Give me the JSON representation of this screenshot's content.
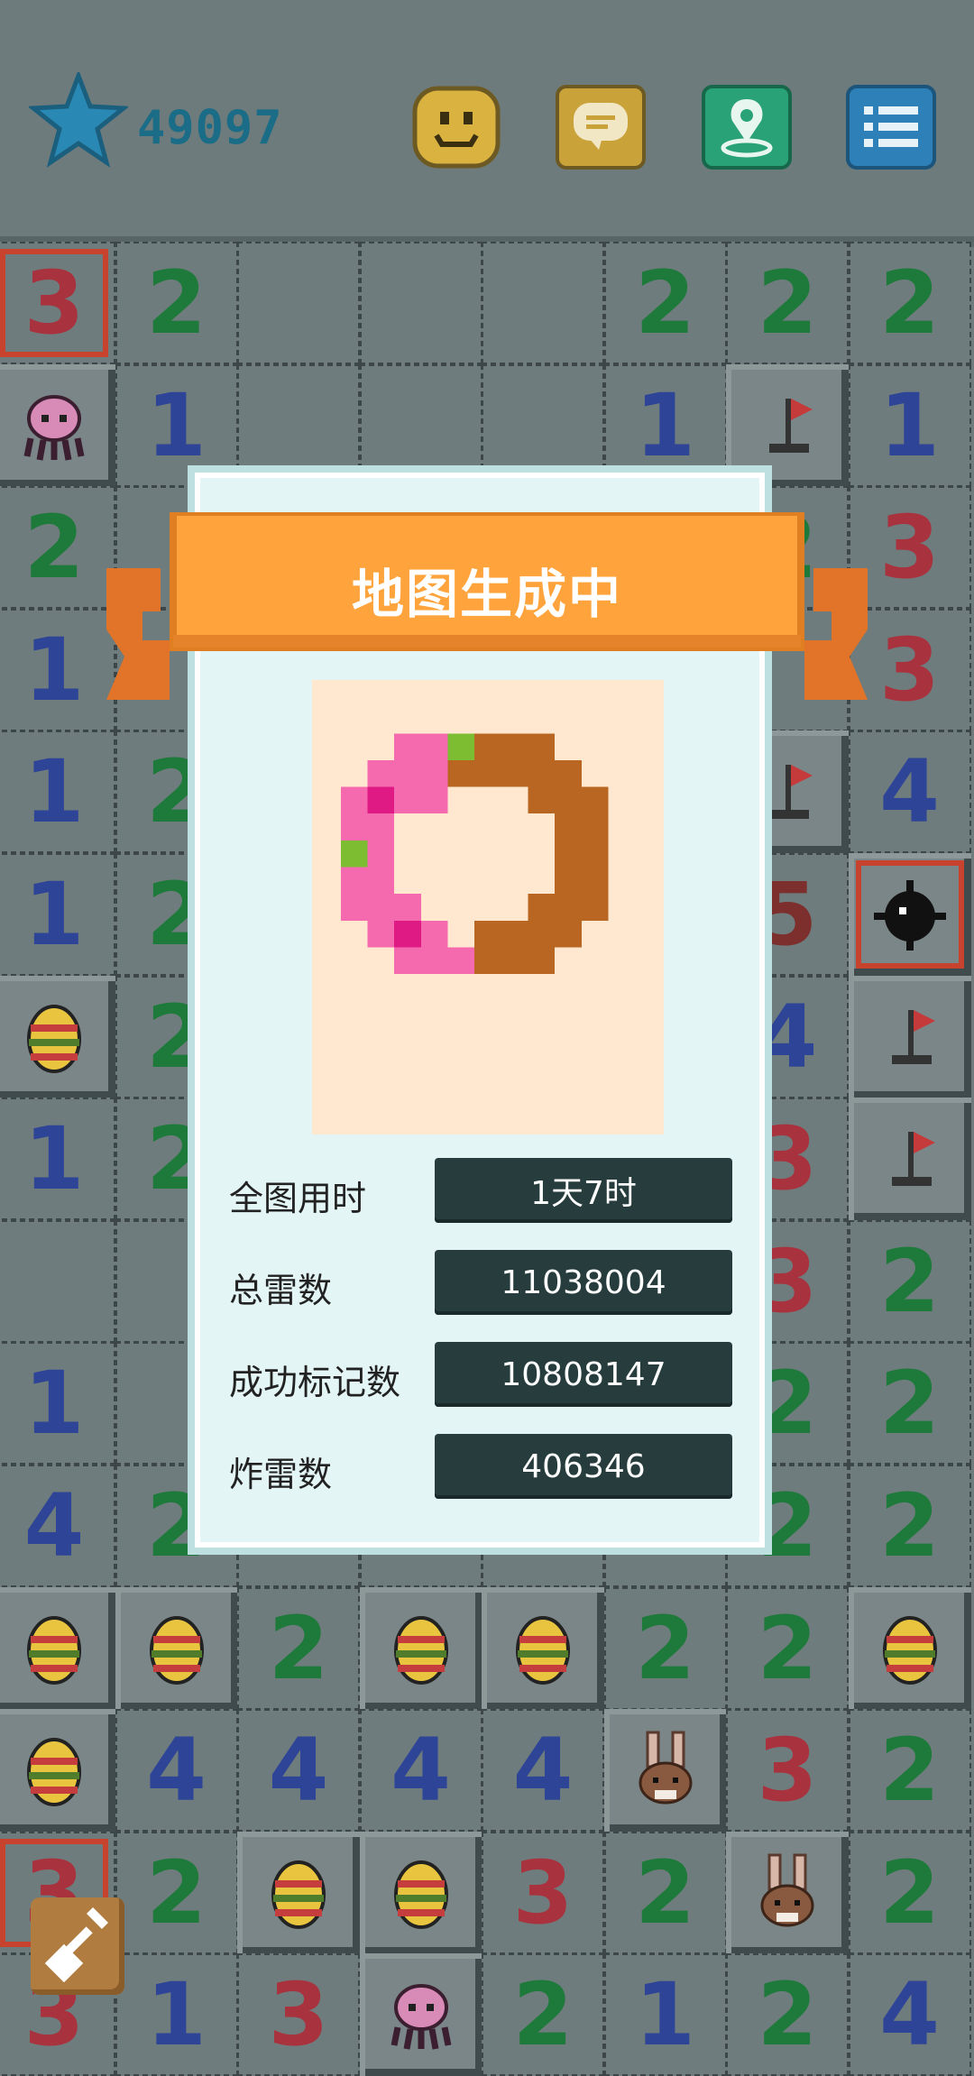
{
  "hud": {
    "star_icon": "star-icon",
    "score": "49097",
    "buttons": [
      "smiley-icon",
      "chat-icon",
      "map-pin-icon",
      "menu-list-icon"
    ]
  },
  "board": {
    "colors": {
      "n1": "#2e4496",
      "n2": "#1e7a3a",
      "n3": "#a8333e",
      "n4": "#2e4496",
      "n5": "#7c2f2c"
    },
    "rows": [
      [
        "3",
        "2",
        "",
        "",
        "",
        "2",
        "2",
        "2"
      ],
      [
        "octopus",
        "1",
        "",
        "",
        "",
        "1",
        "flag",
        "1"
      ],
      [
        "2",
        "",
        "",
        "",
        "",
        "",
        "2",
        "3"
      ],
      [
        "1",
        "",
        "",
        "",
        "",
        "",
        "",
        "3"
      ],
      [
        "1",
        "2",
        "",
        "",
        "",
        "",
        "flag",
        "4"
      ],
      [
        "1",
        "2",
        "",
        "",
        "",
        "",
        "5",
        "mine"
      ],
      [
        "egg",
        "2",
        "",
        "",
        "",
        "",
        "4",
        "flag"
      ],
      [
        "1",
        "2",
        "",
        "",
        "",
        "",
        "3",
        "flag"
      ],
      [
        "",
        "",
        "",
        "",
        "",
        "",
        "3",
        "2"
      ],
      [
        "1",
        "",
        "",
        "",
        "",
        "",
        "2",
        "2"
      ],
      [
        "4",
        "2",
        "",
        "",
        "",
        "",
        "2",
        "2"
      ],
      [
        "egg",
        "egg",
        "2",
        "egg",
        "egg",
        "2",
        "2",
        "egg"
      ],
      [
        "egg",
        "4",
        "4",
        "4",
        "4",
        "bunny",
        "3",
        "2"
      ],
      [
        "3",
        "2",
        "egg",
        "egg",
        "3",
        "2",
        "bunny",
        "2"
      ],
      [
        "3",
        "1",
        "3",
        "octopus",
        "2",
        "1",
        "2",
        "4"
      ]
    ]
  },
  "dialog": {
    "title": "地图生成中",
    "stats": [
      {
        "label": "全图用时",
        "value": "1天7时"
      },
      {
        "label": "总雷数",
        "value": "11038004"
      },
      {
        "label": "成功标记数",
        "value": "10808147"
      },
      {
        "label": "炸雷数",
        "value": "406346"
      }
    ],
    "art": "donut-icon"
  },
  "tool": "shovel-icon"
}
